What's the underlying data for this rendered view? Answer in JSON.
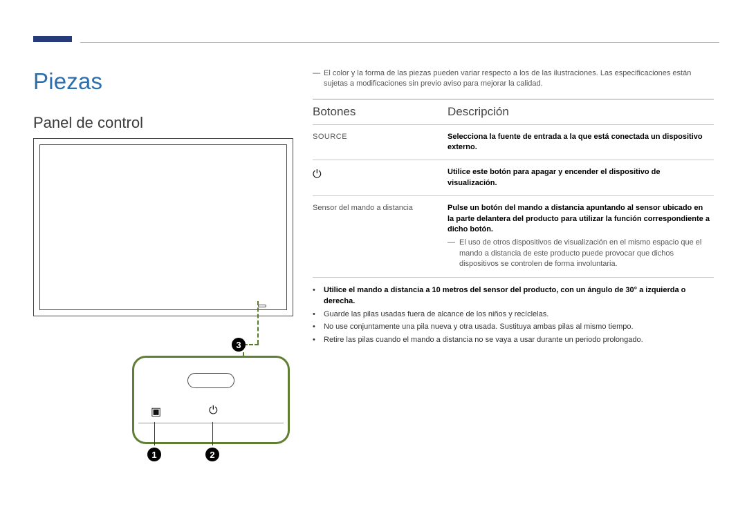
{
  "section": {
    "title": "Piezas",
    "subtitle": "Panel de control"
  },
  "illustration": {
    "marker1": "1",
    "marker2": "2",
    "marker3": "3",
    "src_icon_glyph": "▣",
    "power_glyph": "⏻"
  },
  "top_note": {
    "dash": "―",
    "text": "El color y la forma de las piezas pueden variar respecto a los de las ilustraciones. Las especificaciones están sujetas a modificaciones sin previo aviso para mejorar la calidad."
  },
  "table": {
    "head_key": "Botones",
    "head_desc": "Descripción",
    "rows": {
      "r1": {
        "key": "SOURCE",
        "desc": "Selecciona la fuente de entrada a la que está conectada un dispositivo externo."
      },
      "r2": {
        "key_glyph": "⏻",
        "desc": "Utilice este botón para apagar y encender el dispositivo de visualización."
      },
      "r3": {
        "key": "Sensor del mando a distancia",
        "desc_bold": "Pulse un botón del mando a distancia apuntando al sensor ubicado en la parte delantera del producto para utilizar la función correspondiente a dicho botón.",
        "inner_dash": "―",
        "inner_text": "El uso de otros dispositivos de visualización en el mismo espacio que el mando a distancia de este producto puede provocar que dichos dispositivos se controlen de forma involuntaria."
      }
    }
  },
  "notes": {
    "bullet": "•",
    "n1": "Utilice el mando a distancia a 10 metros del sensor del producto, con un ángulo de 30° a izquierda o derecha.",
    "n2": "Guarde las pilas usadas fuera de alcance de los niños y recíclelas.",
    "n3": "No use conjuntamente una pila nueva y otra usada. Sustituya ambas pilas al mismo tiempo.",
    "n4": "Retire las pilas cuando el mando a distancia no se vaya a usar durante un periodo prolongado."
  }
}
